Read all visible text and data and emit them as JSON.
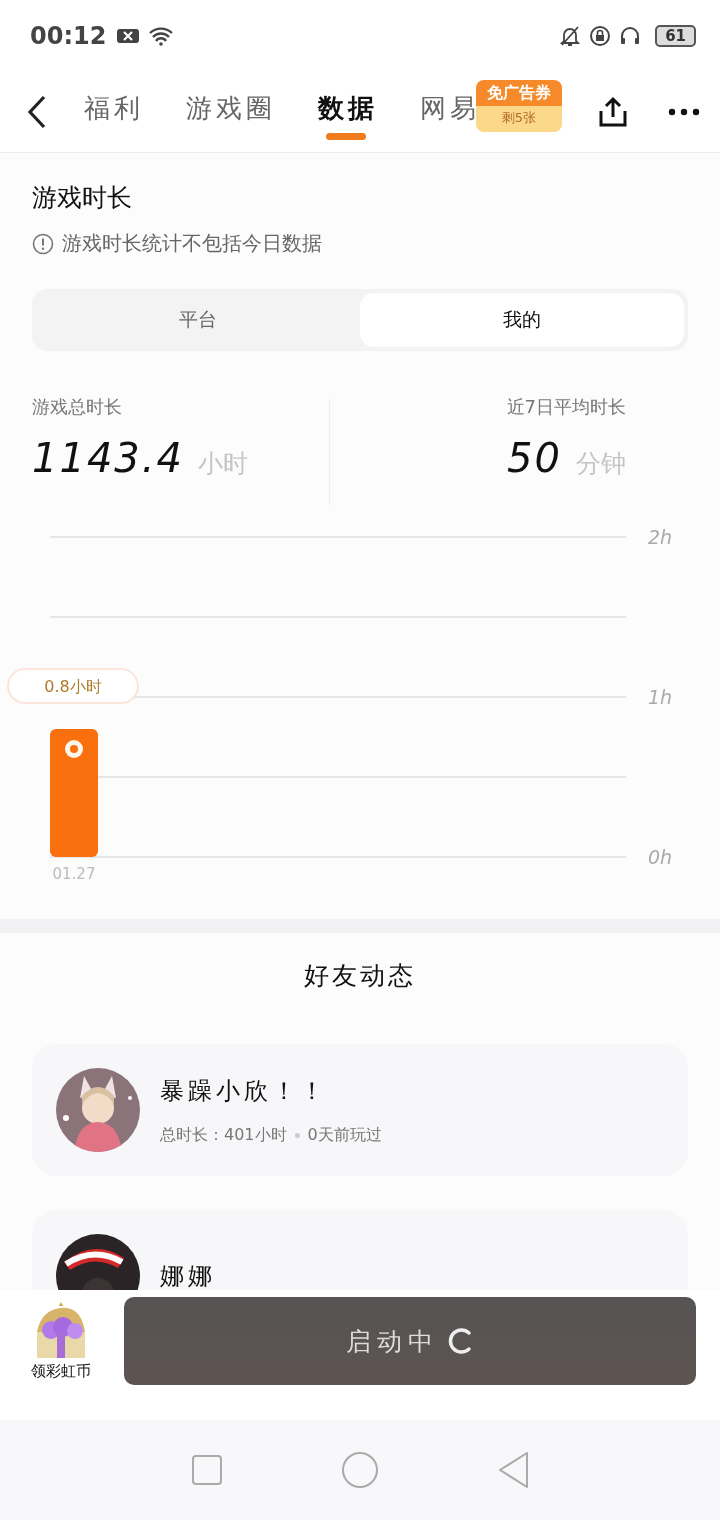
{
  "status_bar": {
    "time": "00:12",
    "battery": "61"
  },
  "nav": {
    "tabs": [
      {
        "label": "福利",
        "selected": false
      },
      {
        "label": "游戏圈",
        "selected": false
      },
      {
        "label": "数据",
        "selected": true
      },
      {
        "label": "网易",
        "selected": false
      }
    ],
    "badge": {
      "title": "免广告券",
      "subtitle": "剩5张"
    }
  },
  "playtime": {
    "title": "游戏时长",
    "notice": "游戏时长统计不包括今日数据",
    "segments": [
      {
        "label": "平台",
        "selected": false
      },
      {
        "label": "我的",
        "selected": true
      }
    ],
    "stats": [
      {
        "label": "游戏总时长",
        "value": "1143.4",
        "unit": "小时"
      },
      {
        "label": "近7日平均时长",
        "value": "50",
        "unit": "分钟"
      }
    ],
    "chart_data": {
      "type": "bar",
      "categories": [
        "01.27"
      ],
      "series": [
        {
          "color": "#fa6f0e",
          "values": [
            0.8
          ]
        }
      ],
      "ylim": [
        0,
        2
      ],
      "yticks": [
        {
          "value": 0,
          "label": "0h"
        },
        {
          "value": 1,
          "label": "1h"
        },
        {
          "value": 2,
          "label": "2h"
        }
      ],
      "value_labels": [
        "0.8小时"
      ]
    }
  },
  "friends": {
    "title": "好友动态",
    "items": [
      {
        "name": "暴躁小欣！！",
        "detail": "总时长：401小时",
        "last_played": "0天前玩过"
      },
      {
        "name": "娜娜"
      }
    ]
  },
  "bottom": {
    "reward_label": "领彩虹币",
    "launch_button": "启动中"
  }
}
